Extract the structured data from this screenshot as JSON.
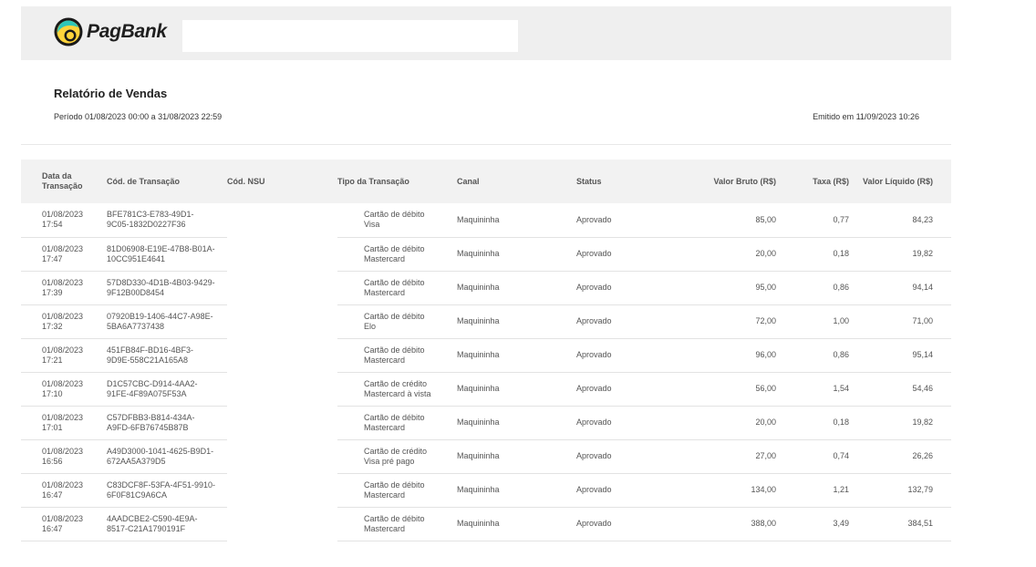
{
  "header": {
    "brand": "PagBank",
    "search_value": ""
  },
  "report": {
    "title": "Relatório de Vendas",
    "period": "Período 01/08/2023 00:00 a 31/08/2023 22:59",
    "issued": "Emitido em 11/09/2023 10:26"
  },
  "table": {
    "columns": {
      "date": "Data da Transação",
      "transaction": "Cód. de Transação",
      "nsu": "Cód. NSU",
      "type": "Tipo da Transação",
      "channel": "Canal",
      "status": "Status",
      "gross": "Valor Bruto (R$)",
      "fee": "Taxa (R$)",
      "net": "Valor Líquido (R$)"
    },
    "rows": [
      {
        "date": "01/08/2023 17:54",
        "transaction": "BFE781C3-E783-49D1-9C05-1832D0227F36",
        "nsu": "",
        "type": "Cartão de débito Visa",
        "channel": "Maquininha",
        "status": "Aprovado",
        "gross": "85,00",
        "fee": "0,77",
        "net": "84,23"
      },
      {
        "date": "01/08/2023 17:47",
        "transaction": "81D06908-E19E-47B8-B01A-10CC951E4641",
        "nsu": "",
        "type": "Cartão de débito Mastercard",
        "channel": "Maquininha",
        "status": "Aprovado",
        "gross": "20,00",
        "fee": "0,18",
        "net": "19,82"
      },
      {
        "date": "01/08/2023 17:39",
        "transaction": "57D8D330-4D1B-4B03-9429-9F12B00D8454",
        "nsu": "",
        "type": "Cartão de débito Mastercard",
        "channel": "Maquininha",
        "status": "Aprovado",
        "gross": "95,00",
        "fee": "0,86",
        "net": "94,14"
      },
      {
        "date": "01/08/2023 17:32",
        "transaction": "07920B19-1406-44C7-A98E-5BA6A7737438",
        "nsu": "",
        "type": "Cartão de débito Elo",
        "channel": "Maquininha",
        "status": "Aprovado",
        "gross": "72,00",
        "fee": "1,00",
        "net": "71,00"
      },
      {
        "date": "01/08/2023 17:21",
        "transaction": "451FB84F-BD16-4BF3-9D9E-558C21A165A8",
        "nsu": "",
        "type": "Cartão de débito Mastercard",
        "channel": "Maquininha",
        "status": "Aprovado",
        "gross": "96,00",
        "fee": "0,86",
        "net": "95,14"
      },
      {
        "date": "01/08/2023 17:10",
        "transaction": "D1C57CBC-D914-4AA2-91FE-4F89A075F53A",
        "nsu": "",
        "type": "Cartão de crédito Mastercard à vista",
        "channel": "Maquininha",
        "status": "Aprovado",
        "gross": "56,00",
        "fee": "1,54",
        "net": "54,46"
      },
      {
        "date": "01/08/2023 17:01",
        "transaction": "C57DFBB3-B814-434A-A9FD-6FB76745B87B",
        "nsu": "",
        "type": "Cartão de débito Mastercard",
        "channel": "Maquininha",
        "status": "Aprovado",
        "gross": "20,00",
        "fee": "0,18",
        "net": "19,82"
      },
      {
        "date": "01/08/2023 16:56",
        "transaction": "A49D3000-1041-4625-B9D1-672AA5A379D5",
        "nsu": "",
        "type": "Cartão de crédito Visa pré pago",
        "channel": "Maquininha",
        "status": "Aprovado",
        "gross": "27,00",
        "fee": "0,74",
        "net": "26,26"
      },
      {
        "date": "01/08/2023 16:47",
        "transaction": "C83DCF8F-53FA-4F51-9910-6F0F81C9A6CA",
        "nsu": "",
        "type": "Cartão de débito Mastercard",
        "channel": "Maquininha",
        "status": "Aprovado",
        "gross": "134,00",
        "fee": "1,21",
        "net": "132,79"
      },
      {
        "date": "01/08/2023 16:47",
        "transaction": "4AADCBE2-C590-4E9A-8517-C21A1790191F",
        "nsu": "",
        "type": "Cartão de débito Mastercard",
        "channel": "Maquininha",
        "status": "Aprovado",
        "gross": "388,00",
        "fee": "3,49",
        "net": "384,51"
      }
    ]
  }
}
